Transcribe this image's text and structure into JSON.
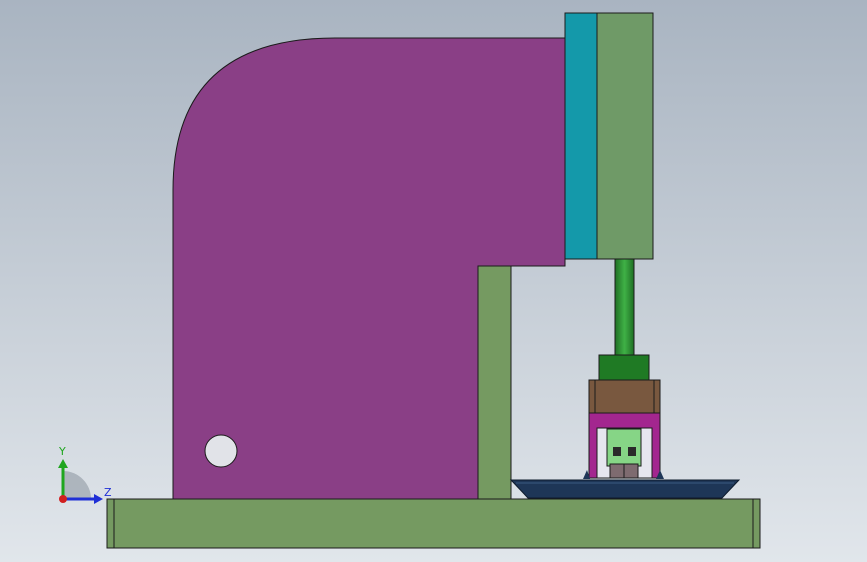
{
  "viewport": {
    "background_top": "#a9b4c1",
    "background_bottom": "#e1e6eb"
  },
  "colors": {
    "frame": "#8a3f86",
    "base": "#759a61",
    "column": "#759a61",
    "cylinder": "#6f9a67",
    "cylinder_flange": "#1499aa",
    "piston_rod": "#2f8f33",
    "ram_head": "#1f7a24",
    "tool_holder": "#79583f",
    "die_frame": "#a3268f",
    "die_block": "#86d586",
    "fixture_plate": "#1e3657",
    "hole": "#e1e3e8",
    "outline": "#1b1b1b"
  },
  "axis_triad": {
    "y_label": "Y",
    "z_label": "Z",
    "y_color": "#1fa61f",
    "z_color": "#1f2fd6",
    "origin_color": "#d11f1f"
  },
  "icons": {
    "triad": "coordinate-axis-icon"
  }
}
